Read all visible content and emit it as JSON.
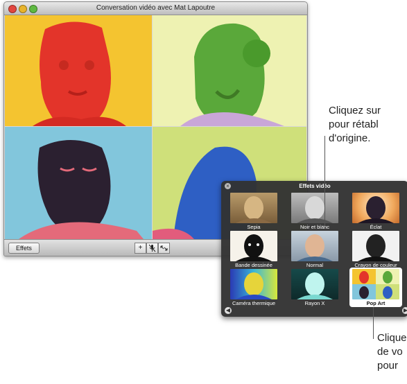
{
  "window": {
    "title": "Conversation vidéo avec Mat Lapoutre",
    "effects_button": "Effets",
    "add_icon": "+",
    "mute_icon": "microphone-mute-icon",
    "fullscreen_icon": "fullscreen-icon"
  },
  "panel": {
    "title": "Effets vidéo",
    "effects": [
      {
        "label": "Sepia",
        "style": "sepia"
      },
      {
        "label": "Noir et blanc",
        "style": "bw"
      },
      {
        "label": "Éclat",
        "style": "glow"
      },
      {
        "label": "Bande dessinée",
        "style": "comic"
      },
      {
        "label": "Normal",
        "style": "normal"
      },
      {
        "label": "Crayon de couleur",
        "style": "pencil"
      },
      {
        "label": "Caméra thermique",
        "style": "thermal"
      },
      {
        "label": "Rayon X",
        "style": "xray"
      },
      {
        "label": "Pop Art",
        "style": "popart"
      }
    ],
    "selected": "Pop Art"
  },
  "callouts": {
    "top": [
      "Cliquez sur",
      "pour rétabl",
      "d'origine."
    ],
    "bottom": [
      "Clique",
      "de vo",
      "pour"
    ]
  }
}
